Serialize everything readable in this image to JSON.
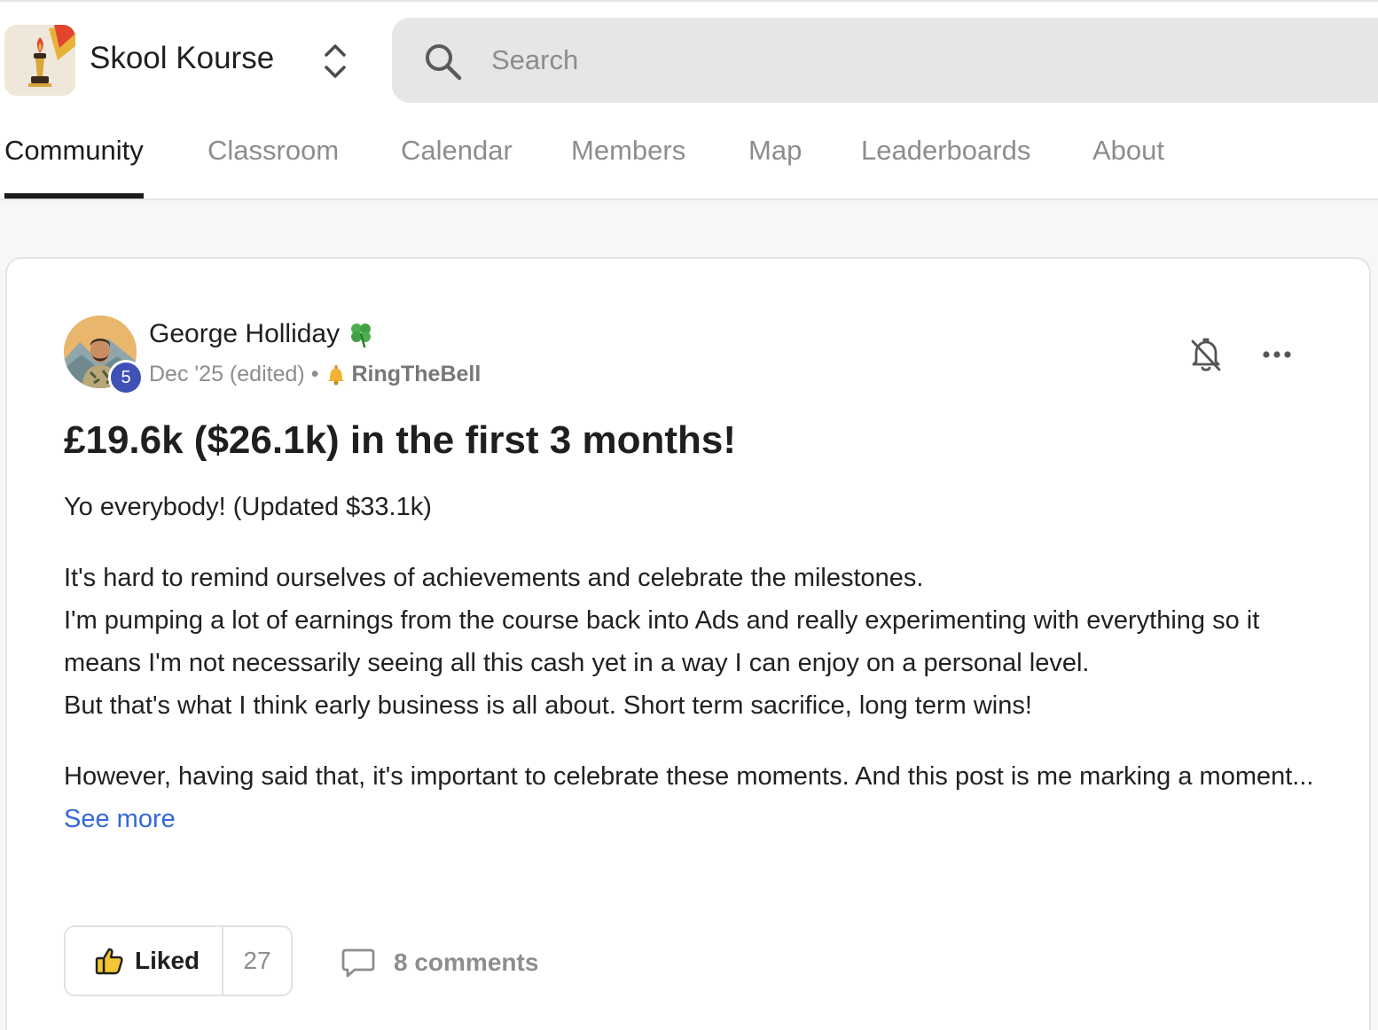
{
  "header": {
    "group_name": "Skool Kourse",
    "logo_icon": "torch-logo-icon",
    "switcher_icon": "chevron-up-down-icon",
    "search": {
      "placeholder": "Search",
      "value": "",
      "icon": "search-icon"
    }
  },
  "tabs": [
    {
      "label": "Community",
      "active": true
    },
    {
      "label": "Classroom",
      "active": false
    },
    {
      "label": "Calendar",
      "active": false
    },
    {
      "label": "Members",
      "active": false
    },
    {
      "label": "Map",
      "active": false
    },
    {
      "label": "Leaderboards",
      "active": false
    },
    {
      "label": "About",
      "active": false
    }
  ],
  "post": {
    "author": {
      "name": "George Holliday",
      "badge_icon": "clover-icon",
      "level": "5"
    },
    "date": "Dec '25 (edited)",
    "separator": "•",
    "category": {
      "icon": "bell-emoji-icon",
      "name": "RingTheBell"
    },
    "actions": {
      "notify_icon": "bell-off-icon",
      "more_icon": "more-dots-icon"
    },
    "title": "£19.6k ($26.1k) in the first 3 months!",
    "paragraphs": [
      "Yo everybody! (Updated $33.1k)",
      "It's hard to remind ourselves of achievements and celebrate the milestones.",
      "I'm pumping a lot of earnings from the course back into Ads and really experimenting with everything so it means I'm not necessarily seeing all this cash yet in a way I can enjoy on a personal level.",
      "But that's what I think early business is all about. Short term sacrifice, long term wins!",
      "However, having said that, it's important to celebrate these moments. And this post is me marking a moment..."
    ],
    "see_more": "See more",
    "like": {
      "label": "Liked",
      "count": "27",
      "icon": "thumbs-up-icon"
    },
    "comments": {
      "label": "8 comments",
      "icon": "comment-icon"
    }
  },
  "colors": {
    "accent_link": "#3468d6",
    "level_badge": "#3f51b5",
    "tab_active": "#1c1c1c",
    "tab_inactive": "#8d8d8d",
    "page_background": "#f8f7f5"
  }
}
